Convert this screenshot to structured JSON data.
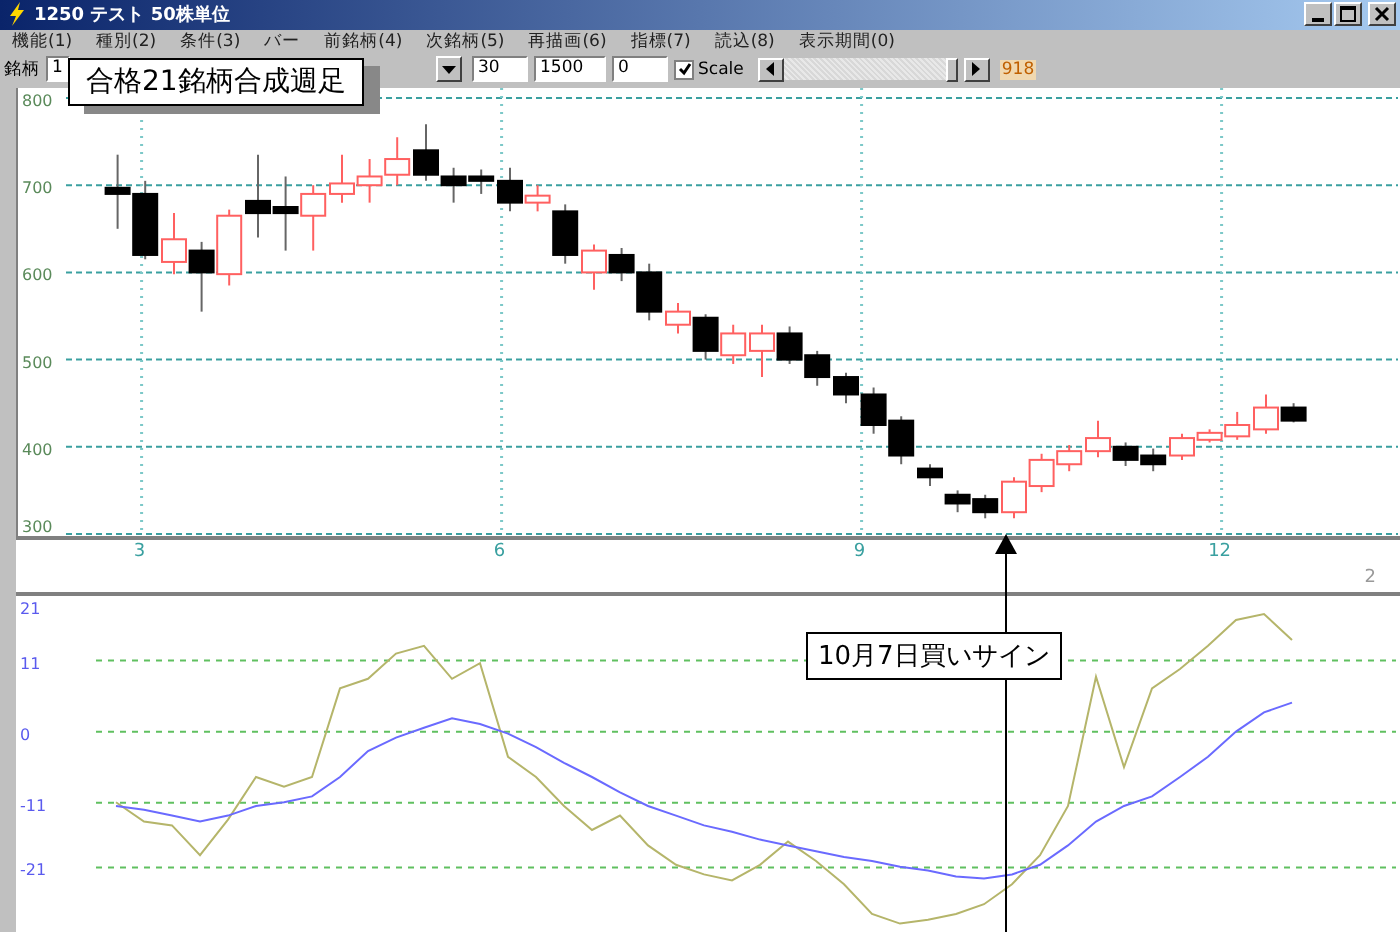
{
  "window": {
    "title": "1250 テスト 50株単位"
  },
  "menu": [
    "機能(1)",
    "種別(2)",
    "条件(3)",
    "バー",
    "前銘柄(4)",
    "次銘柄(5)",
    "再描画(6)",
    "指標(7)",
    "読込(8)",
    "表示期間(0)"
  ],
  "toolbar": {
    "label": "銘柄",
    "code_value": "1",
    "fields": [
      "30",
      "1500",
      "0"
    ],
    "scale": {
      "label": "Scale",
      "checked": true
    },
    "count": "918"
  },
  "upper_panel": {
    "chart_data": {
      "type": "candlestick",
      "ylim": [
        300,
        800
      ],
      "grid": true,
      "yticks": [
        {
          "value": 800,
          "label": "800"
        },
        {
          "value": 700,
          "label": "700"
        },
        {
          "value": 600,
          "label": "600"
        },
        {
          "value": 500,
          "label": "500"
        },
        {
          "value": 400,
          "label": "400"
        },
        {
          "value": 300,
          "label": "300"
        }
      ],
      "xticks": [
        3,
        6,
        9,
        12
      ],
      "xlim": [
        1.97,
        13.47
      ],
      "x": [
        2.8,
        3.03,
        3.27,
        3.5,
        3.73,
        3.97,
        4.2,
        4.43,
        4.67,
        4.9,
        5.13,
        5.37,
        5.6,
        5.83,
        6.07,
        6.3,
        6.53,
        6.77,
        7,
        7.23,
        7.47,
        7.7,
        7.93,
        8.17,
        8.4,
        8.63,
        8.87,
        9.1,
        9.33,
        9.57,
        9.8,
        10.03,
        10.27,
        10.5,
        10.73,
        10.97,
        11.2,
        11.43,
        11.67,
        11.9,
        12.13,
        12.37,
        12.6
      ],
      "ohlc": [
        [
          697,
          735,
          650,
          690
        ],
        [
          690,
          705,
          615,
          620
        ],
        [
          612,
          668,
          598,
          638
        ],
        [
          625,
          635,
          555,
          600
        ],
        [
          598,
          672,
          585,
          665
        ],
        [
          682,
          735,
          640,
          668
        ],
        [
          675,
          710,
          625,
          668
        ],
        [
          665,
          700,
          625,
          690
        ],
        [
          690,
          735,
          680,
          702
        ],
        [
          700,
          730,
          680,
          710
        ],
        [
          712,
          755,
          700,
          730
        ],
        [
          740,
          770,
          705,
          712
        ],
        [
          710,
          720,
          680,
          700
        ],
        [
          710,
          718,
          690,
          705
        ],
        [
          705,
          720,
          670,
          680
        ],
        [
          680,
          700,
          670,
          688
        ],
        [
          670,
          678,
          610,
          620
        ],
        [
          600,
          632,
          580,
          625
        ],
        [
          620,
          628,
          590,
          600
        ],
        [
          600,
          610,
          545,
          555
        ],
        [
          540,
          565,
          530,
          555
        ],
        [
          548,
          552,
          500,
          510
        ],
        [
          505,
          540,
          495,
          530
        ],
        [
          510,
          540,
          480,
          530
        ],
        [
          530,
          538,
          495,
          500
        ],
        [
          505,
          510,
          470,
          480
        ],
        [
          480,
          485,
          450,
          460
        ],
        [
          460,
          468,
          415,
          425
        ],
        [
          430,
          435,
          380,
          390
        ],
        [
          375,
          380,
          355,
          365
        ],
        [
          345,
          350,
          325,
          335
        ],
        [
          340,
          345,
          318,
          325
        ],
        [
          325,
          365,
          318,
          360
        ],
        [
          355,
          392,
          348,
          385
        ],
        [
          380,
          402,
          372,
          395
        ],
        [
          395,
          430,
          388,
          410
        ],
        [
          400,
          405,
          378,
          385
        ],
        [
          390,
          398,
          372,
          380
        ],
        [
          390,
          415,
          385,
          410
        ],
        [
          408,
          420,
          405,
          416
        ],
        [
          412,
          440,
          408,
          425
        ],
        [
          420,
          460,
          415,
          445
        ],
        [
          445,
          450,
          428,
          430
        ]
      ]
    },
    "side_label": "2"
  },
  "lower_panel": {
    "chart_data": {
      "type": "line",
      "ylim": [
        -31,
        21
      ],
      "grid": true,
      "yticks": [
        {
          "value": 21,
          "label": "21"
        },
        {
          "value": 11,
          "label": "11"
        },
        {
          "value": 0,
          "label": "0"
        },
        {
          "value": -11,
          "label": "-11"
        },
        {
          "value": -21,
          "label": "-21"
        }
      ],
      "series": [
        {
          "color": "#b5b56a",
          "values": [
            -10.9,
            -13.9,
            -14.5,
            -19.1,
            -13.6,
            -7,
            -8.5,
            -7,
            6.7,
            8.2,
            12.1,
            13.3,
            8.2,
            10.6,
            -3.9,
            -7,
            -11.5,
            -15.2,
            -13,
            -17.6,
            -20.6,
            -22.1,
            -23,
            -20.6,
            -17,
            -20,
            -23.6,
            -28.2,
            -29.7,
            -29.1,
            -28.2,
            -26.7,
            -23.6,
            -19.1,
            -11.5,
            8.5,
            -5.5,
            6.7,
            9.7,
            13.3,
            17.3,
            18.2,
            14.2
          ]
        },
        {
          "color": "#6a6aff",
          "values": [
            -11.5,
            -12.1,
            -13,
            -13.9,
            -13,
            -11.5,
            -10.9,
            -10,
            -7,
            -3,
            -0.9,
            0.6,
            2.1,
            1.2,
            -0.3,
            -2.4,
            -4.8,
            -7,
            -9.4,
            -11.5,
            -13,
            -14.5,
            -15.5,
            -16.7,
            -17.6,
            -18.5,
            -19.4,
            -20,
            -20.9,
            -21.5,
            -22.4,
            -22.7,
            -22.1,
            -20.6,
            -17.6,
            -13.9,
            -11.5,
            -10,
            -7,
            -3.9,
            0,
            3,
            4.5
          ]
        }
      ]
    }
  },
  "callouts": [
    "合格21銘柄合成週足",
    "10月7日買いサイン"
  ]
}
